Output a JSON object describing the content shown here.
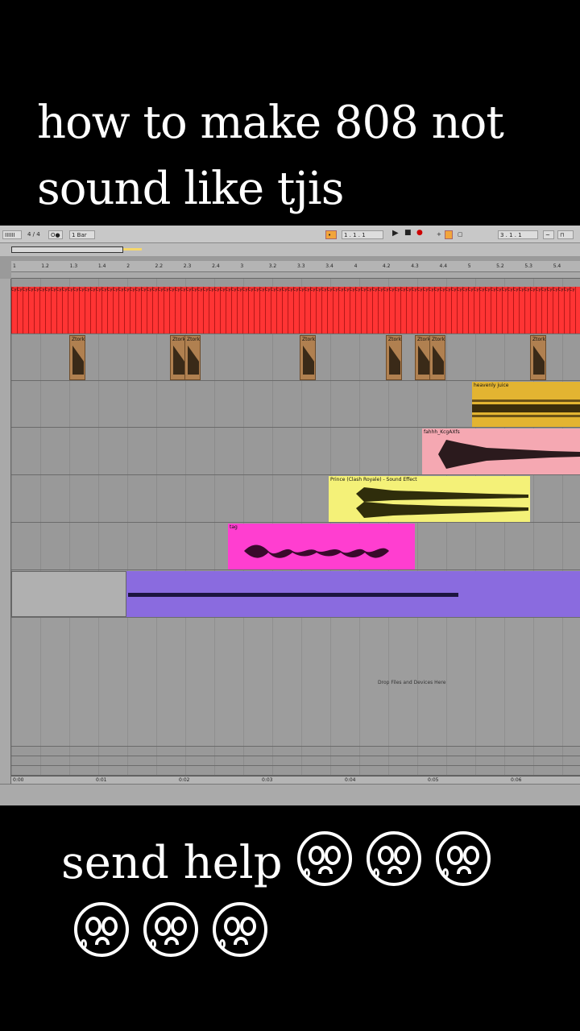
{
  "caption": {
    "top": "how to make 808 not sound like tjis",
    "bottom": "send help"
  },
  "emoji": {
    "name": "face-holding-back-tears-icon",
    "count": 6
  },
  "toolbar": {
    "meter": "4 / 4",
    "metronome": "O●",
    "quantize": "1 Bar",
    "position": "1 . 1 . 1",
    "loop_position": "3 . 1 . 1"
  },
  "ruler": {
    "bars": [
      "1",
      "1.2",
      "1.3",
      "1.4",
      "2",
      "2.2",
      "2.3",
      "2.4",
      "3",
      "3.2",
      "3.3",
      "3.4",
      "4",
      "4.2",
      "4.3",
      "4.4",
      "5",
      "5.2",
      "5.3",
      "5.4"
    ]
  },
  "tracks": {
    "red_clip_label": "Cy",
    "ztork_label": "Ztork",
    "gold_label": "heavenly juice",
    "pink_label": "fahhh_KcgAXfs",
    "yellow_label": "Prince (Clash Royale) - Sound Effect",
    "magenta_label": "tag"
  },
  "drop_hint": "Drop Files and Devices Here",
  "timeline": [
    "0:00",
    "0:01",
    "0:02",
    "0:03",
    "0:04",
    "0:05",
    "0:06"
  ],
  "colors": {
    "red": "#ff3434",
    "ztork": "#b08050",
    "gold": "#e3b431",
    "pink": "#f5a8b2",
    "yellow": "#f4f178",
    "magenta": "#ff3ed0",
    "purple": "#8a6bdf"
  }
}
